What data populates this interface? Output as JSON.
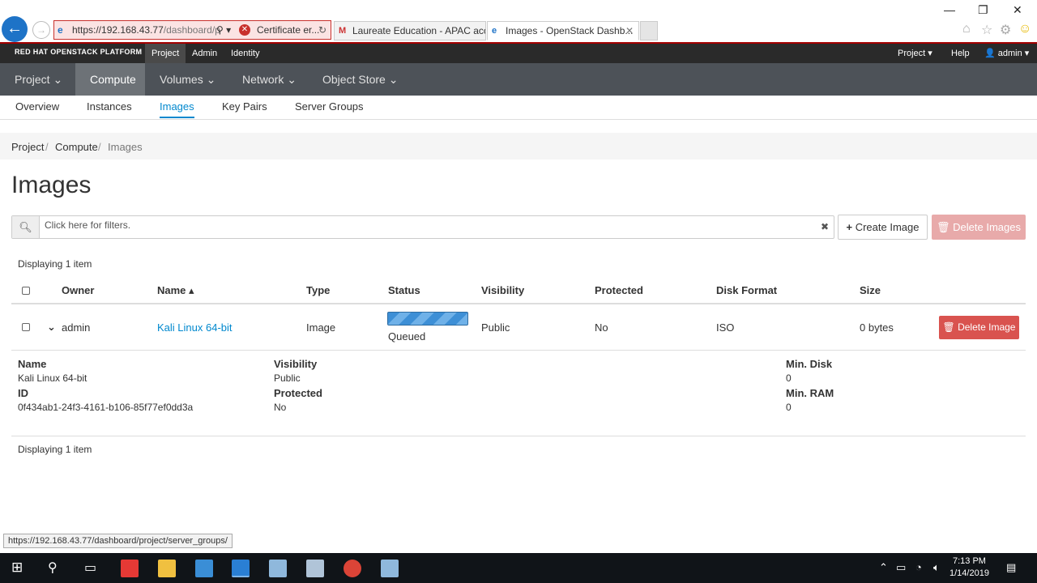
{
  "browser": {
    "url_host": "https://192.168.43.77",
    "url_path": "/dashboard/p",
    "cert_label": "Certificate er...",
    "tabs": [
      {
        "title": "Laureate Education - APAC acc..."
      },
      {
        "title": "Images - OpenStack Dashb..."
      }
    ],
    "status_url": "https://192.168.43.77/dashboard/project/server_groups/"
  },
  "topbar": {
    "brand": "RED HAT OPENSTACK PLATFORM",
    "nav": [
      "Project",
      "Admin",
      "Identity"
    ],
    "project_menu": "Project",
    "help": "Help",
    "user": "admin"
  },
  "nav2": [
    "Project",
    "Compute",
    "Volumes",
    "Network",
    "Object Store"
  ],
  "nav3": [
    "Overview",
    "Instances",
    "Images",
    "Key Pairs",
    "Server Groups"
  ],
  "breadcrumb": [
    "Project",
    "Compute",
    "Images"
  ],
  "page_title": "Images",
  "filter": {
    "placeholder": "Click here for filters."
  },
  "buttons": {
    "create": "Create Image",
    "delete_all": "Delete Images",
    "delete_row": "Delete Image"
  },
  "displaying": "Displaying 1 item",
  "table": {
    "headers": [
      "Owner",
      "Name",
      "Type",
      "Status",
      "Visibility",
      "Protected",
      "Disk Format",
      "Size"
    ],
    "rows": [
      {
        "owner": "admin",
        "name": "Kali Linux 64-bit",
        "type": "Image",
        "status": "Queued",
        "visibility": "Public",
        "protected": "No",
        "disk_format": "ISO",
        "size": "0 bytes"
      }
    ]
  },
  "detail": {
    "name_label": "Name",
    "name": "Kali Linux 64-bit",
    "id_label": "ID",
    "id": "0f434ab1-24f3-4161-b106-85f77ef0dd3a",
    "visibility_label": "Visibility",
    "visibility": "Public",
    "protected_label": "Protected",
    "protected": "No",
    "min_disk_label": "Min. Disk",
    "min_disk": "0",
    "min_ram_label": "Min. RAM",
    "min_ram": "0"
  },
  "taskbar": {
    "time": "7:13 PM",
    "date": "1/14/2019"
  },
  "colors": {
    "accent": "#0088ce",
    "danger": "#d9534f",
    "header_bg": "#2a2a2a",
    "nav_bg": "#4d5258"
  }
}
